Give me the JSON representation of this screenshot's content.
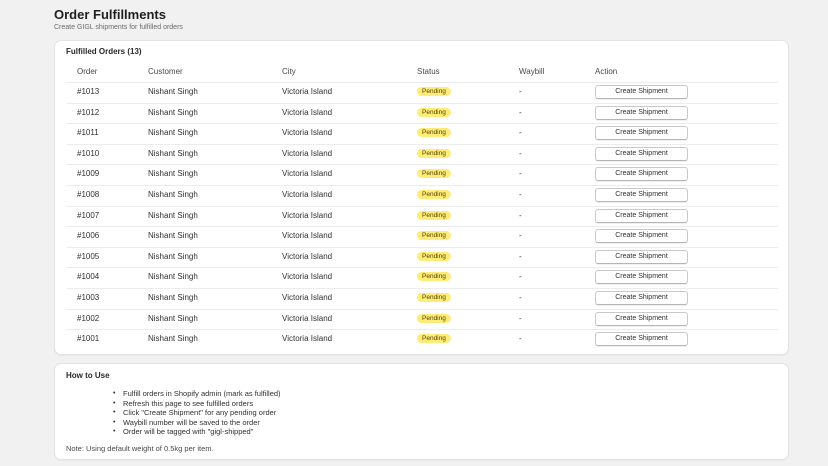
{
  "page": {
    "title": "Order Fulfillments",
    "subtitle": "Create GIGL shipments for fulfilled orders"
  },
  "orders_card": {
    "title": "Fulfilled Orders (13)",
    "columns": [
      "Order",
      "Customer",
      "City",
      "Status",
      "Waybill",
      "Action"
    ],
    "rows": [
      {
        "order": "#1013",
        "customer": "Nishant Singh",
        "city": "Victoria Island",
        "status": "Pending",
        "waybill": "-",
        "action": "Create Shipment"
      },
      {
        "order": "#1012",
        "customer": "Nishant Singh",
        "city": "Victoria Island",
        "status": "Pending",
        "waybill": "-",
        "action": "Create Shipment"
      },
      {
        "order": "#1011",
        "customer": "Nishant Singh",
        "city": "Victoria Island",
        "status": "Pending",
        "waybill": "-",
        "action": "Create Shipment"
      },
      {
        "order": "#1010",
        "customer": "Nishant Singh",
        "city": "Victoria Island",
        "status": "Pending",
        "waybill": "-",
        "action": "Create Shipment"
      },
      {
        "order": "#1009",
        "customer": "Nishant Singh",
        "city": "Victoria Island",
        "status": "Pending",
        "waybill": "-",
        "action": "Create Shipment"
      },
      {
        "order": "#1008",
        "customer": "Nishant Singh",
        "city": "Victoria Island",
        "status": "Pending",
        "waybill": "-",
        "action": "Create Shipment"
      },
      {
        "order": "#1007",
        "customer": "Nishant Singh",
        "city": "Victoria Island",
        "status": "Pending",
        "waybill": "-",
        "action": "Create Shipment"
      },
      {
        "order": "#1006",
        "customer": "Nishant Singh",
        "city": "Victoria Island",
        "status": "Pending",
        "waybill": "-",
        "action": "Create Shipment"
      },
      {
        "order": "#1005",
        "customer": "Nishant Singh",
        "city": "Victoria Island",
        "status": "Pending",
        "waybill": "-",
        "action": "Create Shipment"
      },
      {
        "order": "#1004",
        "customer": "Nishant Singh",
        "city": "Victoria Island",
        "status": "Pending",
        "waybill": "-",
        "action": "Create Shipment"
      },
      {
        "order": "#1003",
        "customer": "Nishant Singh",
        "city": "Victoria Island",
        "status": "Pending",
        "waybill": "-",
        "action": "Create Shipment"
      },
      {
        "order": "#1002",
        "customer": "Nishant Singh",
        "city": "Victoria Island",
        "status": "Pending",
        "waybill": "-",
        "action": "Create Shipment"
      },
      {
        "order": "#1001",
        "customer": "Nishant Singh",
        "city": "Victoria Island",
        "status": "Pending",
        "waybill": "-",
        "action": "Create Shipment"
      }
    ]
  },
  "howto": {
    "title": "How to Use",
    "steps": [
      "Fulfill orders in Shopify admin (mark as fulfilled)",
      "Refresh this page to see fulfilled orders",
      "Click \"Create Shipment\" for any pending order",
      "Waybill number will be saved to the order",
      "Order will be tagged with \"gigl-shipped\""
    ],
    "note": "Note: Using default weight of 0.5kg per item."
  },
  "colors": {
    "page_bg": "#f1f1f1",
    "card_bg": "#ffffff",
    "pending_badge": "#ffeb78"
  }
}
